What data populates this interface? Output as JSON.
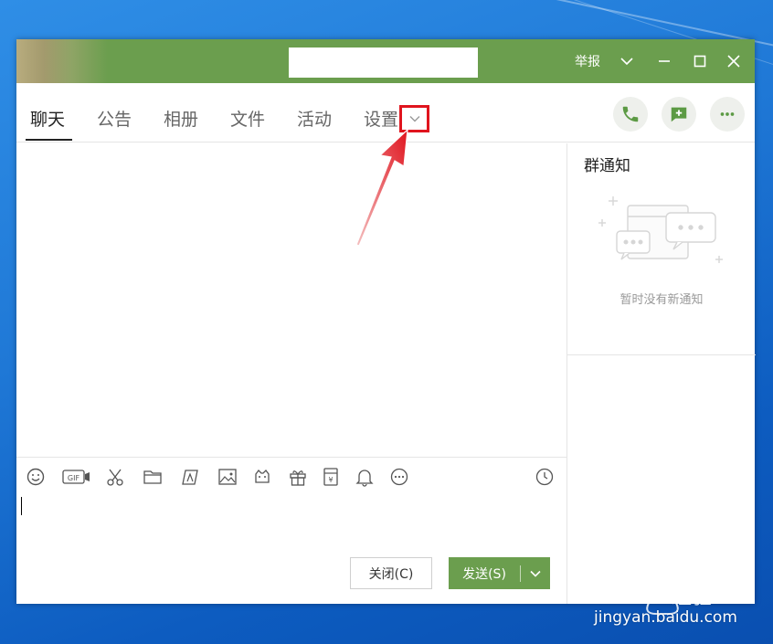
{
  "titlebar": {
    "report_label": "举报",
    "icons": [
      "chevron-down-icon",
      "minimize-icon",
      "maximize-icon",
      "close-icon"
    ]
  },
  "tabs": {
    "items": [
      {
        "label": "聊天",
        "active": true
      },
      {
        "label": "公告",
        "active": false
      },
      {
        "label": "相册",
        "active": false
      },
      {
        "label": "文件",
        "active": false
      },
      {
        "label": "活动",
        "active": false
      },
      {
        "label": "设置",
        "active": false
      }
    ],
    "actions": [
      "phone-icon",
      "add-chat-icon",
      "more-icon"
    ]
  },
  "side_panel": {
    "title": "群通知",
    "empty_text": "暂时没有新通知"
  },
  "toolbar": {
    "tools": [
      "emoji-icon",
      "gif-icon",
      "scissors-icon",
      "folder-icon",
      "doodle-icon",
      "image-icon",
      "sticker-icon",
      "gift-icon",
      "red-packet-icon",
      "bell-icon",
      "more-icon",
      "history-clock-icon"
    ]
  },
  "buttons": {
    "close_label": "关闭(C)",
    "send_label": "发送(S)"
  },
  "watermark": {
    "brand": "Baidu",
    "cn": "经验",
    "url": "jingyan.baidu.com"
  },
  "colors": {
    "accent_green": "#6b9e4e",
    "highlight_red": "#e0141e"
  }
}
